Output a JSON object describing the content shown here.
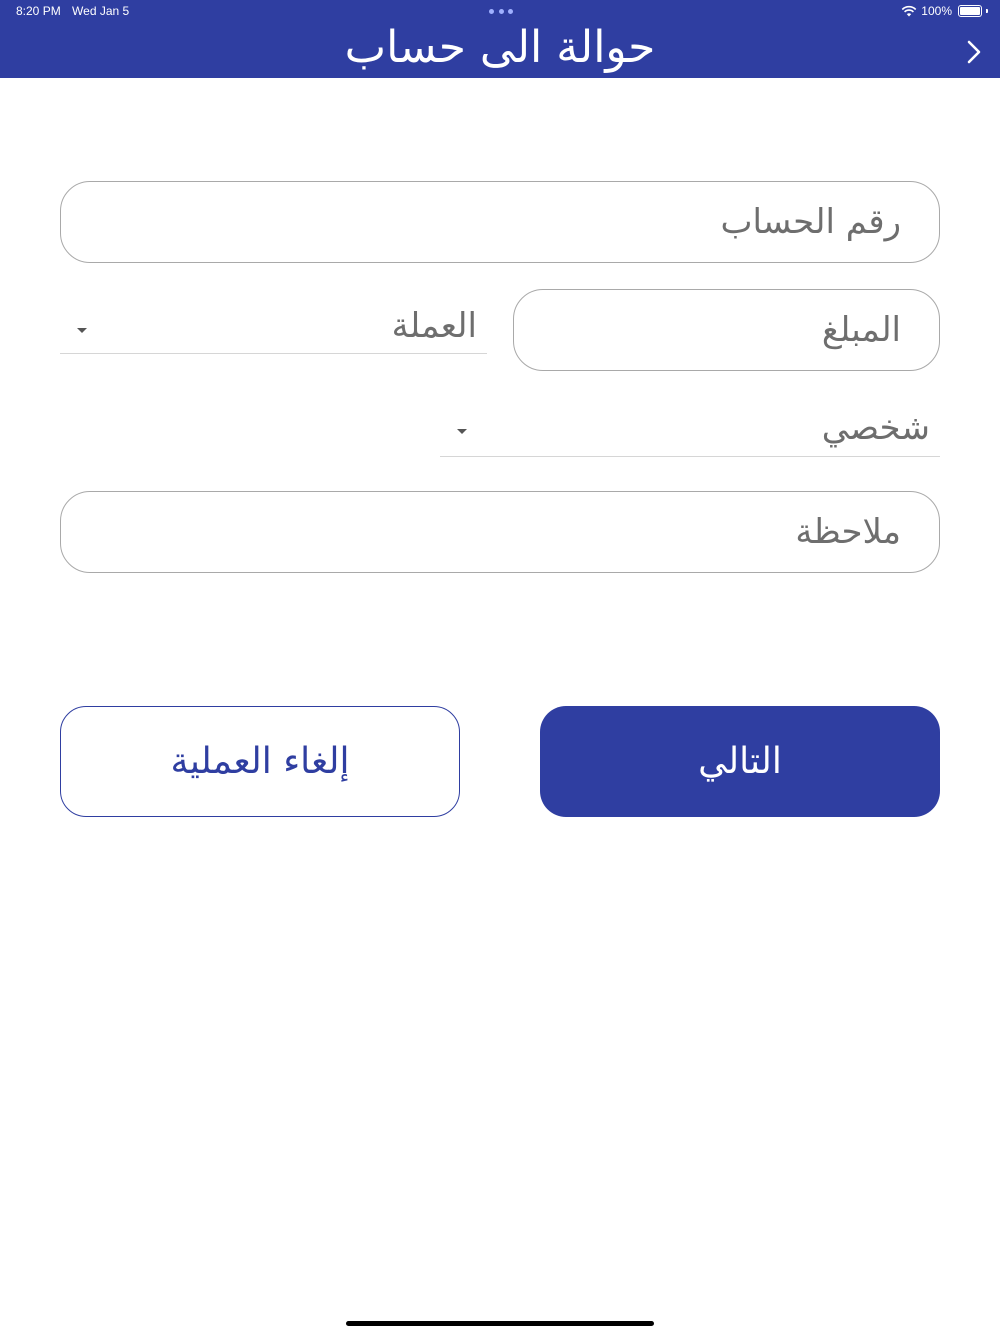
{
  "status_bar": {
    "time": "8:20 PM",
    "date": "Wed Jan 5",
    "battery": "100%"
  },
  "header": {
    "title": "حوالة الى حساب",
    "back_icon": "chevron-right-icon"
  },
  "form": {
    "account_number_placeholder": "رقم الحساب",
    "amount_placeholder": "المبلغ",
    "currency_label": "العملة",
    "type_label": "شخصي",
    "note_placeholder": "ملاحظة"
  },
  "actions": {
    "next_label": "التالي",
    "cancel_label": "إلغاء العملية"
  },
  "colors": {
    "primary": "#2f3ea1",
    "field_border": "#a9a9a9",
    "placeholder": "#6e6e6e"
  }
}
